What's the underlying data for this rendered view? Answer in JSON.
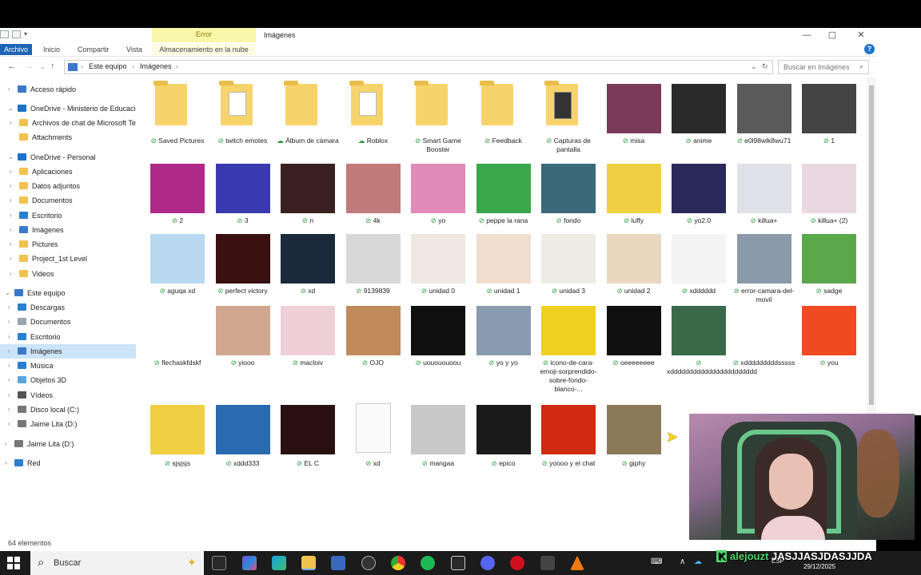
{
  "window": {
    "title": "Imágenes",
    "context_tab": "Error",
    "context_subtab": "Almacenamiento en la nube",
    "ribbon_tabs": [
      "Archivo",
      "Inicio",
      "Compartir",
      "Vista"
    ],
    "minimize": "—",
    "maximize": "▢",
    "close": "✕",
    "help": "?"
  },
  "address": {
    "crumbs": [
      "Este equipo",
      "Imágenes"
    ],
    "search_placeholder": "Buscar en Imágenes",
    "refresh_icon": "refresh-icon",
    "dropdown_icon": "chevron-down-icon"
  },
  "sidebar": {
    "items": [
      {
        "label": "Acceso rápido",
        "icon": "star-icon",
        "color": "#3a7ac8",
        "chev": "›"
      },
      {
        "label": "OneDrive - Ministerio de Educación",
        "icon": "cloud-icon",
        "color": "#1e73c8",
        "chev": "⌄"
      },
      {
        "label": "Archivos de chat de Microsoft Teams",
        "icon": "folder-icon",
        "color": "#f2c24f",
        "chev": "›"
      },
      {
        "label": "Attachments",
        "icon": "folder-icon",
        "color": "#f2c24f",
        "chev": ""
      },
      {
        "label": "OneDrive - Personal",
        "icon": "cloud-icon",
        "color": "#1e73c8",
        "chev": "⌄"
      },
      {
        "label": "Aplicaciones",
        "icon": "folder-icon",
        "color": "#f2c24f",
        "chev": "›"
      },
      {
        "label": "Datos adjuntos",
        "icon": "folder-icon",
        "color": "#f2c24f",
        "chev": "›"
      },
      {
        "label": "Documentos",
        "icon": "folder-icon",
        "color": "#f2c24f",
        "chev": "›"
      },
      {
        "label": "Escritorio",
        "icon": "desktop-icon",
        "color": "#2a7fd0",
        "chev": "›"
      },
      {
        "label": "Imágenes",
        "icon": "images-icon",
        "color": "#3a7ac8",
        "chev": "›"
      },
      {
        "label": "Pictures",
        "icon": "folder-icon",
        "color": "#f2c24f",
        "chev": "›"
      },
      {
        "label": "Project_1st Level",
        "icon": "folder-icon",
        "color": "#f2c24f",
        "chev": "›"
      },
      {
        "label": "Videos",
        "icon": "folder-icon",
        "color": "#f2c24f",
        "chev": "›"
      },
      {
        "label": "Este equipo",
        "icon": "pc-icon",
        "color": "#3a7ac8",
        "chev": "⌄"
      },
      {
        "label": "Descargas",
        "icon": "download-icon",
        "color": "#2a7fd0",
        "chev": "›"
      },
      {
        "label": "Documentos",
        "icon": "document-icon",
        "color": "#9aa4b0",
        "chev": "›"
      },
      {
        "label": "Escritorio",
        "icon": "desktop-icon",
        "color": "#2a7fd0",
        "chev": "›"
      },
      {
        "label": "Imágenes",
        "icon": "images-icon",
        "color": "#3a7ac8",
        "chev": "›"
      },
      {
        "label": "Música",
        "icon": "music-icon",
        "color": "#2a7fd0",
        "chev": "›"
      },
      {
        "label": "Objetos 3D",
        "icon": "cube-icon",
        "color": "#5aa7e0",
        "chev": "›"
      },
      {
        "label": "Vídeos",
        "icon": "video-icon",
        "color": "#555555",
        "chev": "›"
      },
      {
        "label": "Disco local (C:)",
        "icon": "drive-icon",
        "color": "#777777",
        "chev": "›"
      },
      {
        "label": "Jaime Lita  (D:)",
        "icon": "drive-icon",
        "color": "#777777",
        "chev": "›"
      },
      {
        "label": "Jaime Lita  (D:)",
        "icon": "drive-icon",
        "color": "#777777",
        "chev": "›"
      },
      {
        "label": "Red",
        "icon": "network-icon",
        "color": "#2a7fd0",
        "chev": "›"
      }
    ]
  },
  "status": "64 elementos",
  "files": [
    {
      "name": "Saved Pictures",
      "kind": "folder"
    },
    {
      "name": "twitch emotes",
      "kind": "folder-docs"
    },
    {
      "name": "Álbum de cámara",
      "kind": "folder",
      "cloud": true
    },
    {
      "name": "Roblox",
      "kind": "folder-doc",
      "cloud": true
    },
    {
      "name": "Smart Game Booster",
      "kind": "folder"
    },
    {
      "name": "Feedback",
      "kind": "folder"
    },
    {
      "name": "Capturas de pantalla",
      "kind": "folder-img"
    },
    {
      "name": "misa",
      "kind": "image",
      "color": "#7a3a5a"
    },
    {
      "name": "anime",
      "kind": "image",
      "color": "#2a2a2a"
    },
    {
      "name": "e0l98wlk8wu71",
      "kind": "image",
      "color": "#5a5a5a"
    },
    {
      "name": "1",
      "kind": "image",
      "color": "#444444"
    },
    {
      "name": "2",
      "kind": "image",
      "color": "#b02a8a"
    },
    {
      "name": "3",
      "kind": "image",
      "color": "#3a3ab0"
    },
    {
      "name": "n",
      "kind": "image",
      "color": "#3a2020"
    },
    {
      "name": "4k",
      "kind": "image",
      "color": "#c07a7a"
    },
    {
      "name": "yo",
      "kind": "image",
      "color": "#e08ab8"
    },
    {
      "name": "peppe la rana",
      "kind": "image",
      "color": "#3aa84a"
    },
    {
      "name": "fondo",
      "kind": "image",
      "color": "#3a6a7a"
    },
    {
      "name": "luffy",
      "kind": "image",
      "color": "#f0d040"
    },
    {
      "name": "yo2.0",
      "kind": "image",
      "color": "#2a2a5a"
    },
    {
      "name": "killua+",
      "kind": "image",
      "color": "#e0e0e8"
    },
    {
      "name": "killua+ (2)",
      "kind": "image",
      "color": "#ead8e0"
    },
    {
      "name": "aguqa xd",
      "kind": "image",
      "color": "#b8d8f0"
    },
    {
      "name": "perfect victory",
      "kind": "image",
      "color": "#3a1010"
    },
    {
      "name": "xd",
      "kind": "image",
      "color": "#1a2a3a"
    },
    {
      "name": "9139839",
      "kind": "image",
      "color": "#d8d8d8"
    },
    {
      "name": "unidad 0",
      "kind": "image",
      "color": "#f0e8e0"
    },
    {
      "name": "unidad 1",
      "kind": "image",
      "color": "#f0ddd0"
    },
    {
      "name": "unidad 3",
      "kind": "image",
      "color": "#ecece4"
    },
    {
      "name": "unidad 2",
      "kind": "image",
      "color": "#e8d8c0"
    },
    {
      "name": "xdddddd",
      "kind": "image",
      "color": "#f4f4f4"
    },
    {
      "name": "error-camara-del-movil",
      "kind": "image",
      "color": "#8a9aa8"
    },
    {
      "name": "sadge",
      "kind": "image",
      "color": "#5aa84a"
    },
    {
      "name": "flechaskfdskf",
      "kind": "image",
      "color": "#ffffff"
    },
    {
      "name": "yiooo",
      "kind": "image",
      "color": "#d0a890"
    },
    {
      "name": "macloiv",
      "kind": "image",
      "color": "#f0d0d8"
    },
    {
      "name": "OJO",
      "kind": "image",
      "color": "#c08a5a"
    },
    {
      "name": "uouououoou",
      "kind": "image",
      "color": "#101010"
    },
    {
      "name": "yo y yo",
      "kind": "image",
      "color": "#8a9ab0"
    },
    {
      "name": "icono-de-cara-emoji-sorprendido-sobre-fondo-blanco-...",
      "kind": "image",
      "color": "#f0d020"
    },
    {
      "name": "oeeeeeeee",
      "kind": "image",
      "color": "#101010"
    },
    {
      "name": "xddddddddddddddddddddddd",
      "kind": "image",
      "color": "#3a6a4a"
    },
    {
      "name": "xdddddddddsssss",
      "kind": "image",
      "color": "#ffffff"
    },
    {
      "name": "you",
      "kind": "image",
      "color": "#f04a20"
    },
    {
      "name": "sjsjsjs",
      "kind": "image",
      "color": "#f0d040"
    },
    {
      "name": "xddd333",
      "kind": "image",
      "color": "#2a6ab0"
    },
    {
      "name": "EL C",
      "kind": "image",
      "color": "#2a1010"
    },
    {
      "name": "xd",
      "kind": "doc"
    },
    {
      "name": "mangaa",
      "kind": "image",
      "color": "#c8c8c8"
    },
    {
      "name": "epico",
      "kind": "image",
      "color": "#1a1a1a"
    },
    {
      "name": "yoooo y el chat",
      "kind": "image",
      "color": "#d02a10"
    },
    {
      "name": "giphy",
      "kind": "image",
      "color": "#8a7a5a"
    }
  ],
  "taskbar": {
    "search": "Buscar",
    "user_overlay": "alejouzt",
    "stream_text": "JASJJASJDASJJDA",
    "time": "29/12/2025",
    "lang": "ESP"
  }
}
